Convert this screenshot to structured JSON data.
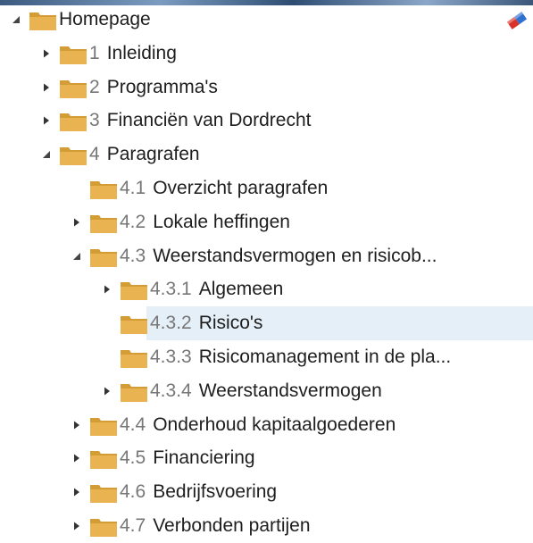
{
  "tree": [
    {
      "num": "",
      "label": "Homepage",
      "toggle": "expanded",
      "depth": 0
    },
    {
      "num": "1",
      "label": "Inleiding",
      "toggle": "collapsed",
      "depth": 1
    },
    {
      "num": "2",
      "label": "Programma's",
      "toggle": "collapsed",
      "depth": 1
    },
    {
      "num": "3",
      "label": "Financiën van Dordrecht",
      "toggle": "collapsed",
      "depth": 1
    },
    {
      "num": "4",
      "label": "Paragrafen",
      "toggle": "expanded",
      "depth": 1
    },
    {
      "num": "4.1",
      "label": "Overzicht paragrafen",
      "toggle": "none",
      "depth": 2
    },
    {
      "num": "4.2",
      "label": "Lokale heffingen",
      "toggle": "collapsed",
      "depth": 2
    },
    {
      "num": "4.3",
      "label": "Weerstandsvermogen en risicob...",
      "toggle": "expanded",
      "depth": 2
    },
    {
      "num": "4.3.1",
      "label": "Algemeen",
      "toggle": "collapsed",
      "depth": 3
    },
    {
      "num": "4.3.2",
      "label": "Risico's",
      "toggle": "none",
      "depth": 3,
      "selected": true
    },
    {
      "num": "4.3.3",
      "label": "Risicomanagement in de pla...",
      "toggle": "none",
      "depth": 3
    },
    {
      "num": "4.3.4",
      "label": "Weerstandsvermogen",
      "toggle": "collapsed",
      "depth": 3
    },
    {
      "num": "4.4",
      "label": "Onderhoud kapitaalgoederen",
      "toggle": "collapsed",
      "depth": 2
    },
    {
      "num": "4.5",
      "label": "Financiering",
      "toggle": "collapsed",
      "depth": 2
    },
    {
      "num": "4.6",
      "label": "Bedrijfsvoering",
      "toggle": "collapsed",
      "depth": 2
    },
    {
      "num": "4.7",
      "label": "Verbonden partijen",
      "toggle": "collapsed",
      "depth": 2
    }
  ],
  "icons": {
    "folder": "folder-icon",
    "expanded": "triangle-expanded-icon",
    "collapsed": "triangle-collapsed-icon",
    "eraser": "eraser-icon"
  },
  "colors": {
    "folder": "#e8b350",
    "folder_dark": "#d39c35",
    "selected_bg": "#e5eff8",
    "number": "#777777",
    "text": "#1e1e1e"
  }
}
